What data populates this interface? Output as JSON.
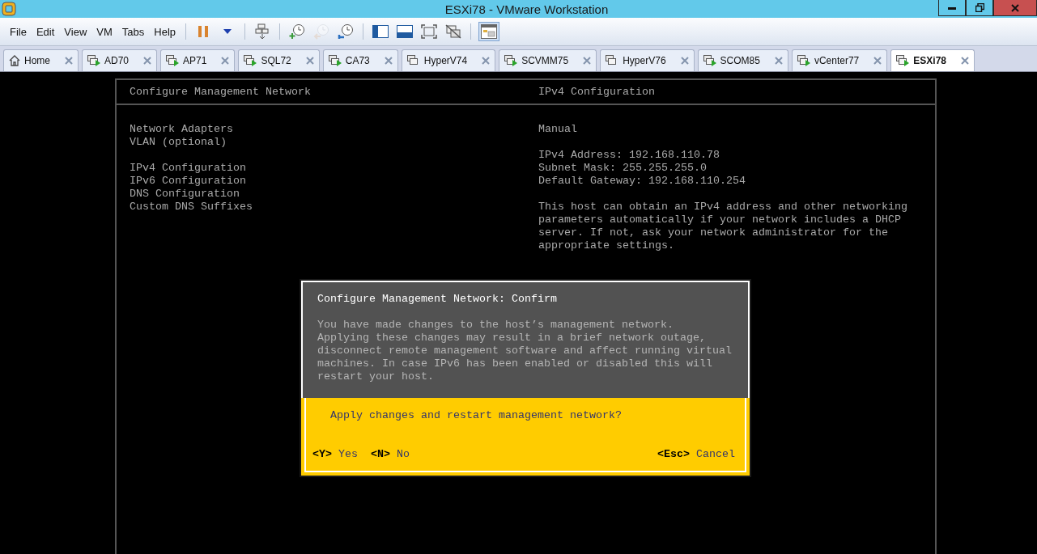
{
  "window": {
    "title": "ESXi78 - VMware Workstation"
  },
  "menu": [
    "File",
    "Edit",
    "View",
    "VM",
    "Tabs",
    "Help"
  ],
  "toolbar": [
    {
      "kind": "pause",
      "disabled": false,
      "selected": false
    },
    {
      "kind": "dropdown",
      "disabled": false,
      "selected": false
    },
    {
      "kind": "send-keys",
      "disabled": false,
      "selected": false
    },
    {
      "kind": "snapshot-take",
      "disabled": false,
      "selected": false
    },
    {
      "kind": "snapshot-revert",
      "disabled": true,
      "selected": false
    },
    {
      "kind": "snapshot-manager",
      "disabled": false,
      "selected": false
    },
    {
      "kind": "sidebar",
      "disabled": false,
      "selected": false
    },
    {
      "kind": "console",
      "disabled": false,
      "selected": false
    },
    {
      "kind": "fullscreen",
      "disabled": false,
      "selected": false
    },
    {
      "kind": "unity",
      "disabled": false,
      "selected": false
    },
    {
      "kind": "thumbnails",
      "disabled": false,
      "selected": true
    }
  ],
  "tabs": [
    {
      "label": "Home",
      "kind": "home",
      "selected": false
    },
    {
      "label": "AD70",
      "kind": "vm",
      "running": true,
      "selected": false
    },
    {
      "label": "AP71",
      "kind": "vm",
      "running": true,
      "selected": false
    },
    {
      "label": "SQL72",
      "kind": "vm",
      "running": true,
      "selected": false
    },
    {
      "label": "CA73",
      "kind": "vm",
      "running": true,
      "selected": false
    },
    {
      "label": "HyperV74",
      "kind": "vm",
      "running": false,
      "selected": false
    },
    {
      "label": "SCVMM75",
      "kind": "vm",
      "running": true,
      "selected": false
    },
    {
      "label": "HyperV76",
      "kind": "vm",
      "running": false,
      "selected": false
    },
    {
      "label": "SCOM85",
      "kind": "vm",
      "running": true,
      "selected": false
    },
    {
      "label": "vCenter77",
      "kind": "vm",
      "running": true,
      "selected": false
    },
    {
      "label": "ESXi78",
      "kind": "vm",
      "running": true,
      "selected": true
    }
  ],
  "console": {
    "title": "Configure Management Network",
    "detail_title": "IPv4 Configuration",
    "menu_groups": [
      [
        "Network Adapters",
        "VLAN (optional)"
      ],
      [
        "IPv4 Configuration",
        "IPv6 Configuration",
        "DNS Configuration",
        "Custom DNS Suffixes"
      ]
    ],
    "mode": "Manual",
    "settings": [
      "IPv4 Address: 192.168.110.78",
      "Subnet Mask: 255.255.255.0",
      "Default Gateway: 192.168.110.254"
    ],
    "description": "This host can obtain an IPv4 address and other networking parameters automatically if your network includes a DHCP server. If not, ask your network administrator for the appropriate settings."
  },
  "dialog": {
    "title": "Configure Management Network: Confirm",
    "message": [
      "You have made changes to the host’s management network.",
      "Applying these changes may result in a brief network outage, disconnect remote management software and affect running virtual machines. In case IPv6 has been enabled or disabled this will restart your host."
    ],
    "question": "Apply changes and restart management network?",
    "actions_left": [
      {
        "key": "<Y>",
        "label": "Yes"
      },
      {
        "key": "<N>",
        "label": "No"
      }
    ],
    "actions_right": [
      {
        "key": "<Esc>",
        "label": "Cancel"
      }
    ]
  }
}
